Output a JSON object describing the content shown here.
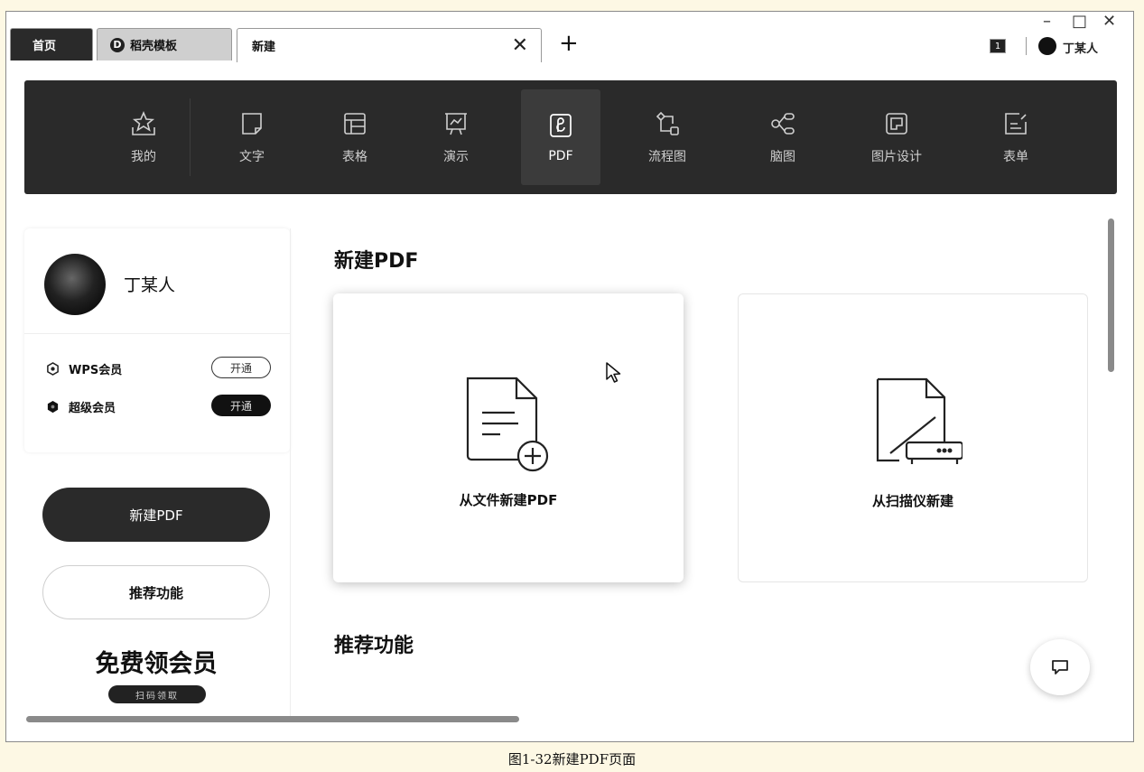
{
  "tabs": {
    "home": "首页",
    "template": "稻壳模板",
    "template_logo": "D",
    "new": "新建",
    "close_glyph": "✕",
    "add_glyph": "+"
  },
  "window_controls": {
    "minimize": "–",
    "maximize": "□",
    "close": "✕"
  },
  "notification_count": "1",
  "user": {
    "name": "丁某人"
  },
  "topnav": [
    {
      "label": "我的",
      "icon": "star-icon"
    },
    {
      "label": "文字",
      "icon": "document-icon"
    },
    {
      "label": "表格",
      "icon": "table-icon"
    },
    {
      "label": "演示",
      "icon": "presentation-icon"
    },
    {
      "label": "PDF",
      "icon": "pdf-icon",
      "active": true
    },
    {
      "label": "流程图",
      "icon": "flowchart-icon"
    },
    {
      "label": "脑图",
      "icon": "mindmap-icon"
    },
    {
      "label": "图片设计",
      "icon": "image-design-icon"
    },
    {
      "label": "表单",
      "icon": "form-icon"
    }
  ],
  "sidebar": {
    "members": [
      {
        "label": "WPS会员",
        "action": "开通"
      },
      {
        "label": "超级会员",
        "action": "开通"
      }
    ],
    "new_pdf_button": "新建PDF",
    "recommend_button": "推荐功能",
    "promo_title": "免费领会员",
    "promo_scan": "扫码领取"
  },
  "main": {
    "section_new_title": "新建PDF",
    "cards": [
      {
        "label": "从文件新建PDF",
        "icon": "new-file-icon"
      },
      {
        "label": "从扫描仪新建",
        "icon": "scanner-icon"
      }
    ],
    "section_recommend_title": "推荐功能"
  },
  "caption": "图1-32新建PDF页面"
}
